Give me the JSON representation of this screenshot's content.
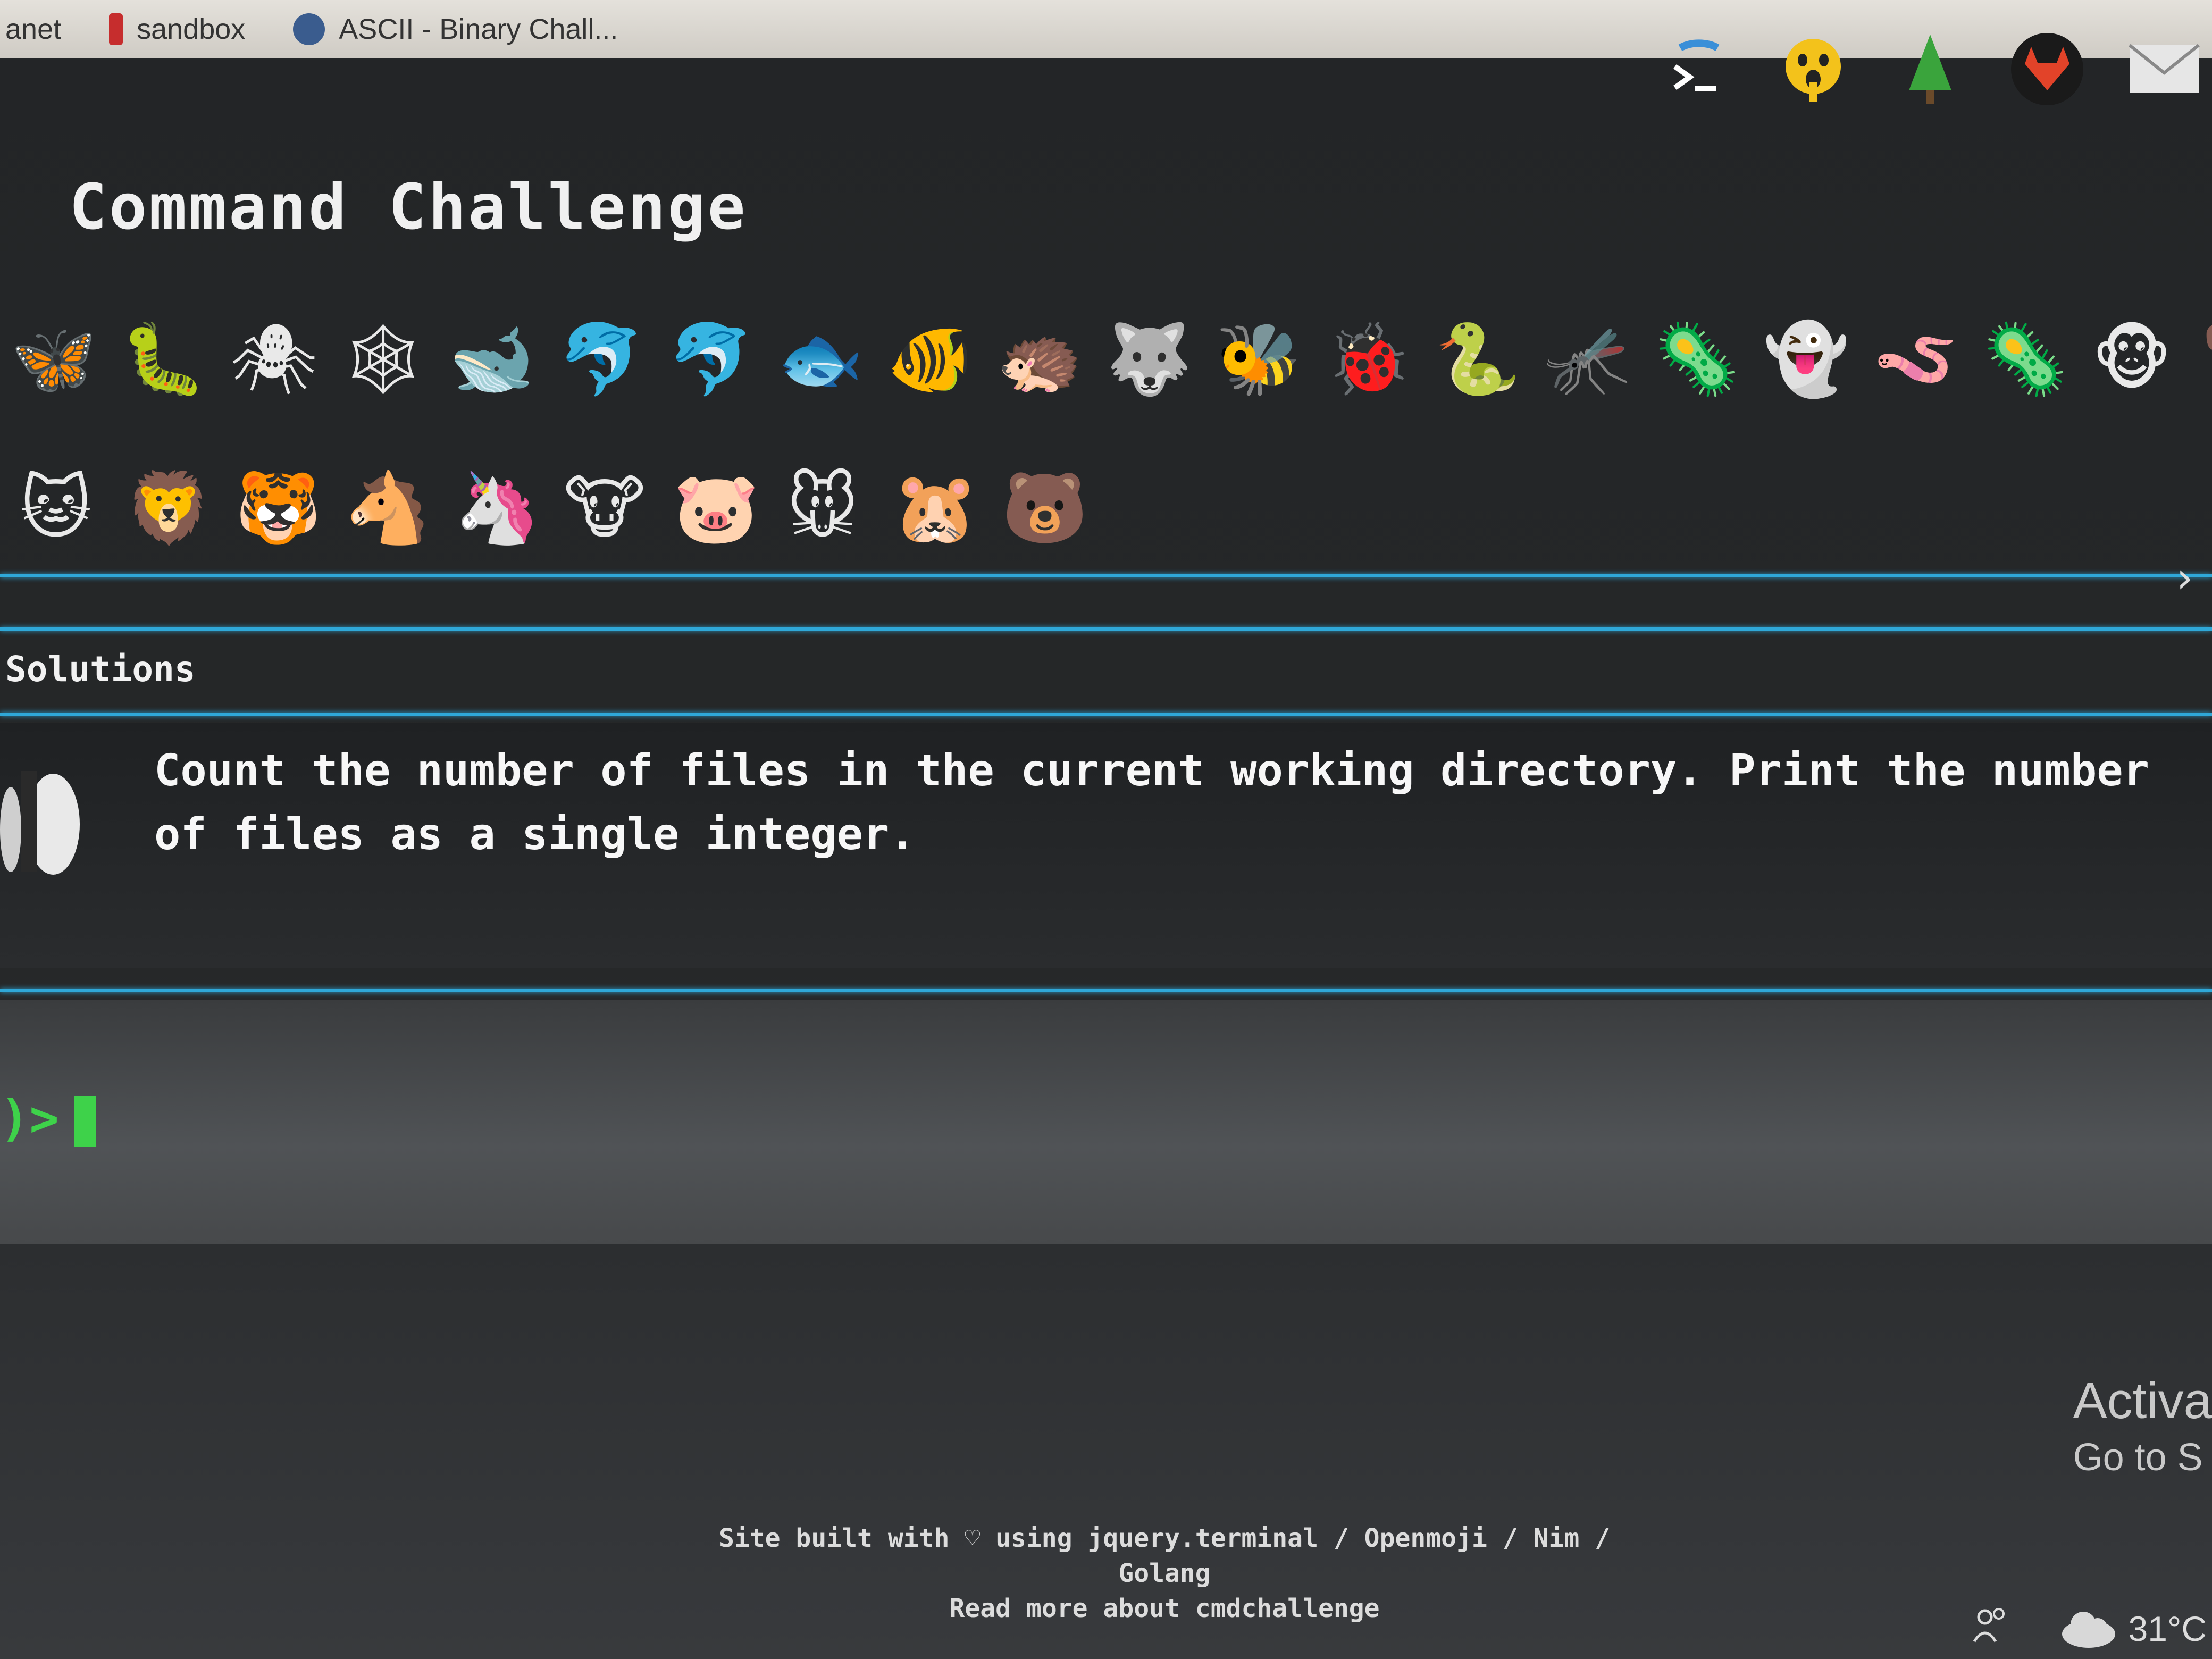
{
  "bookmarks": [
    {
      "label": "anet",
      "fav": "#777"
    },
    {
      "label": "sandbox",
      "fav": "#c62d2d"
    },
    {
      "label": "ASCII - Binary Chall...",
      "fav": "#3a5c8e"
    }
  ],
  "header": {
    "title": "Command Challenge",
    "icons": [
      "terminal-icon",
      "ghost-face-icon",
      "tree-icon",
      "gitlab-icon",
      "mail-icon"
    ]
  },
  "emoji_row1": [
    "🦋",
    "🐛",
    "🕷",
    "🕸",
    "🐋",
    "🐬",
    "🐬",
    "🐟",
    "🐠",
    "🦔",
    "🐺",
    "🐝",
    "🐞",
    "🐍",
    "🦟",
    "🦠",
    "👻",
    "🪱",
    "🦠",
    "🐵",
    "🐕"
  ],
  "emoji_row2": [
    "🐱",
    "🦁",
    "🐯",
    "🐴",
    "🦄",
    "🐮",
    "🐷",
    "🐭",
    "🐹",
    "🐻"
  ],
  "nav": {
    "expand_chevron": "›"
  },
  "solutions": {
    "label": "Solutions"
  },
  "task": {
    "text": "Count the number of files in the current working directory. Print the number of files as a single integer."
  },
  "prompt": {
    "symbol": ")>"
  },
  "watermark": {
    "line1": "Activa",
    "line2": "Go to S"
  },
  "footer": {
    "line1": "Site built with ♡ using jquery.terminal / Openmoji / Nim / Golang",
    "line2": "Read more about cmdchallenge"
  },
  "taskbar": {
    "weather": "31°C"
  }
}
